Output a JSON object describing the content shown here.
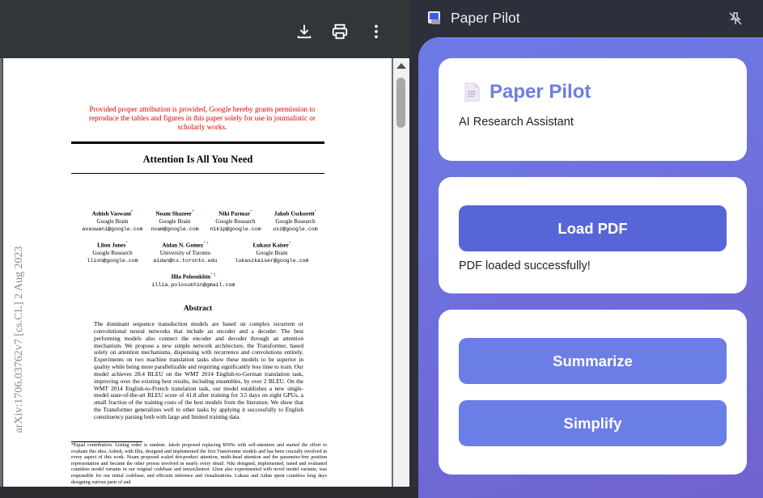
{
  "viewer": {
    "toolbar": {
      "download_icon": "download-icon",
      "print_icon": "print-icon",
      "more_icon": "more-vert-icon"
    },
    "page": {
      "notice": "Provided proper attribution is provided, Google hereby grants permission to reproduce the tables and figures in this paper solely for use in journalistic or scholarly works.",
      "title": "Attention Is All You Need",
      "arxiv_stamp": "arXiv:1706.03762v7  [cs.CL]  2 Aug 2023",
      "authors": [
        {
          "name": "Ashish Vaswani",
          "mark": "*",
          "affil": "Google Brain",
          "email": "avaswani@google.com"
        },
        {
          "name": "Noam Shazeer",
          "mark": "*",
          "affil": "Google Brain",
          "email": "noam@google.com"
        },
        {
          "name": "Niki Parmar",
          "mark": "*",
          "affil": "Google Research",
          "email": "nikip@google.com"
        },
        {
          "name": "Jakob Uszkoreit",
          "mark": "*",
          "affil": "Google Research",
          "email": "usz@google.com"
        },
        {
          "name": "Llion Jones",
          "mark": "*",
          "affil": "Google Research",
          "email": "llion@google.com"
        },
        {
          "name": "Aidan N. Gomez",
          "mark": "* †",
          "affil": "University of Toronto",
          "email": "aidan@cs.toronto.edu"
        },
        {
          "name": "Łukasz Kaiser",
          "mark": "*",
          "affil": "Google Brain",
          "email": "lukaszkaiser@google.com"
        },
        {
          "name": "Illia Polosukhin",
          "mark": "* ‡",
          "affil": "",
          "email": "illia.polosukhin@gmail.com"
        }
      ],
      "abstract_heading": "Abstract",
      "abstract_text": "The dominant sequence transduction models are based on complex recurrent or convolutional neural networks that include an encoder and a decoder. The best performing models also connect the encoder and decoder through an attention mechanism. We propose a new simple network architecture, the Transformer, based solely on attention mechanisms, dispensing with recurrence and convolutions entirely. Experiments on two machine translation tasks show these models to be superior in quality while being more parallelizable and requiring significantly less time to train. Our model achieves 28.4 BLEU on the WMT 2014 English-to-German translation task, improving over the existing best results, including ensembles, by over 2 BLEU. On the WMT 2014 English-to-French translation task, our model establishes a new single-model state-of-the-art BLEU score of 41.8 after training for 3.5 days on eight GPUs, a small fraction of the training costs of the best models from the literature. We show that the Transformer generalizes well to other tasks by applying it successfully to English constituency parsing both with large and limited training data.",
      "footnote": "*Equal contribution. Listing order is random. Jakob proposed replacing RNNs with self-attention and started the effort to evaluate this idea. Ashish, with Illia, designed and implemented the first Transformer models and has been crucially involved in every aspect of this work. Noam proposed scaled dot-product attention, multi-head attention and the parameter-free position representation and became the other person involved in nearly every detail. Niki designed, implemented, tuned and evaluated countless model variants in our original codebase and tensor2tensor. Llion also experimented with novel model variants, was responsible for our initial codebase, and efficient inference and visualizations. Lukasz and Aidan spent countless long days designing various parts of and"
    }
  },
  "panel": {
    "title": "Paper Pilot",
    "app_name": "Paper Pilot",
    "app_subtitle": "AI Research Assistant",
    "load_button": "Load PDF",
    "load_status": "PDF loaded successfully!",
    "summarize_button": "Summarize",
    "simplify_button": "Simplify"
  }
}
